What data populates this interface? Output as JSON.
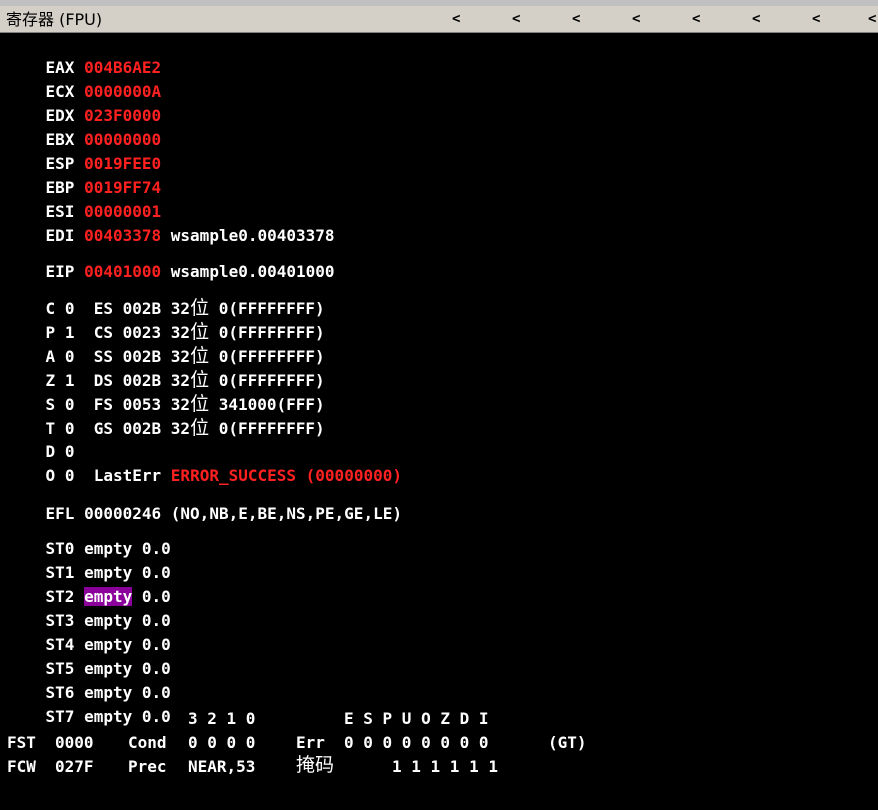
{
  "title": "寄存器 (FPU)",
  "arrows": [
    "<",
    "<",
    "<",
    "<",
    "<",
    "<",
    "<",
    "<"
  ],
  "registers": [
    {
      "name": "EAX",
      "value": "004B6AE2",
      "symbol": ""
    },
    {
      "name": "ECX",
      "value": "0000000A",
      "symbol": ""
    },
    {
      "name": "EDX",
      "value": "023F0000",
      "symbol": ""
    },
    {
      "name": "EBX",
      "value": "00000000",
      "symbol": ""
    },
    {
      "name": "ESP",
      "value": "0019FEE0",
      "symbol": ""
    },
    {
      "name": "EBP",
      "value": "0019FF74",
      "symbol": ""
    },
    {
      "name": "ESI",
      "value": "00000001",
      "symbol": ""
    },
    {
      "name": "EDI",
      "value": "00403378",
      "symbol": "wsample0.00403378"
    }
  ],
  "eip": {
    "name": "EIP",
    "value": "00401000",
    "symbol": "wsample0.00401000"
  },
  "flags": [
    {
      "flag": "C",
      "value": "0",
      "seg": "ES",
      "sel": "002B",
      "bits": "32",
      "unit": "位",
      "base": "0(FFFFFFFF)"
    },
    {
      "flag": "P",
      "value": "1",
      "seg": "CS",
      "sel": "0023",
      "bits": "32",
      "unit": "位",
      "base": "0(FFFFFFFF)"
    },
    {
      "flag": "A",
      "value": "0",
      "seg": "SS",
      "sel": "002B",
      "bits": "32",
      "unit": "位",
      "base": "0(FFFFFFFF)"
    },
    {
      "flag": "Z",
      "value": "1",
      "seg": "DS",
      "sel": "002B",
      "bits": "32",
      "unit": "位",
      "base": "0(FFFFFFFF)"
    },
    {
      "flag": "S",
      "value": "0",
      "seg": "FS",
      "sel": "0053",
      "bits": "32",
      "unit": "位",
      "base": "341000(FFF)"
    },
    {
      "flag": "T",
      "value": "0",
      "seg": "GS",
      "sel": "002B",
      "bits": "32",
      "unit": "位",
      "base": "0(FFFFFFFF)"
    },
    {
      "flag": "D",
      "value": "0"
    },
    {
      "flag": "O",
      "value": "0"
    }
  ],
  "lasterr": {
    "label": "LastErr",
    "value": "ERROR_SUCCESS (00000000)"
  },
  "efl": {
    "label": "EFL",
    "value": "00000246",
    "desc": "(NO,NB,E,BE,NS,PE,GE,LE)"
  },
  "st": [
    {
      "name": "ST0",
      "tag": "empty",
      "value": "0.0"
    },
    {
      "name": "ST1",
      "tag": "empty",
      "value": "0.0"
    },
    {
      "name": "ST2",
      "tag": "empty",
      "value": "0.0"
    },
    {
      "name": "ST3",
      "tag": "empty",
      "value": "0.0"
    },
    {
      "name": "ST4",
      "tag": "empty",
      "value": "0.0"
    },
    {
      "name": "ST5",
      "tag": "empty",
      "value": "0.0"
    },
    {
      "name": "ST6",
      "tag": "empty",
      "value": "0.0"
    },
    {
      "name": "ST7",
      "tag": "empty",
      "value": "0.0"
    }
  ],
  "fpu": {
    "cond_header": "3 2 1 0",
    "err_header": "E S P U O Z D I",
    "fst_label": "FST",
    "fst_value": "0000",
    "cond_label": "Cond",
    "cond_bits": "0 0 0 0",
    "err_label": "Err",
    "err_bits": "0 0 0 0 0 0 0 0",
    "gt": "(GT)",
    "fcw_label": "FCW",
    "fcw_value": "027F",
    "prec_label": "Prec",
    "prec_value": "NEAR,53",
    "mask_label": "掩码",
    "mask_bits": "1 1 1 1 1 1"
  },
  "colors": {
    "value_red": "#ff2020",
    "highlight": "#8b009b",
    "background": "#000000",
    "titlebar": "#d4d0c8"
  }
}
